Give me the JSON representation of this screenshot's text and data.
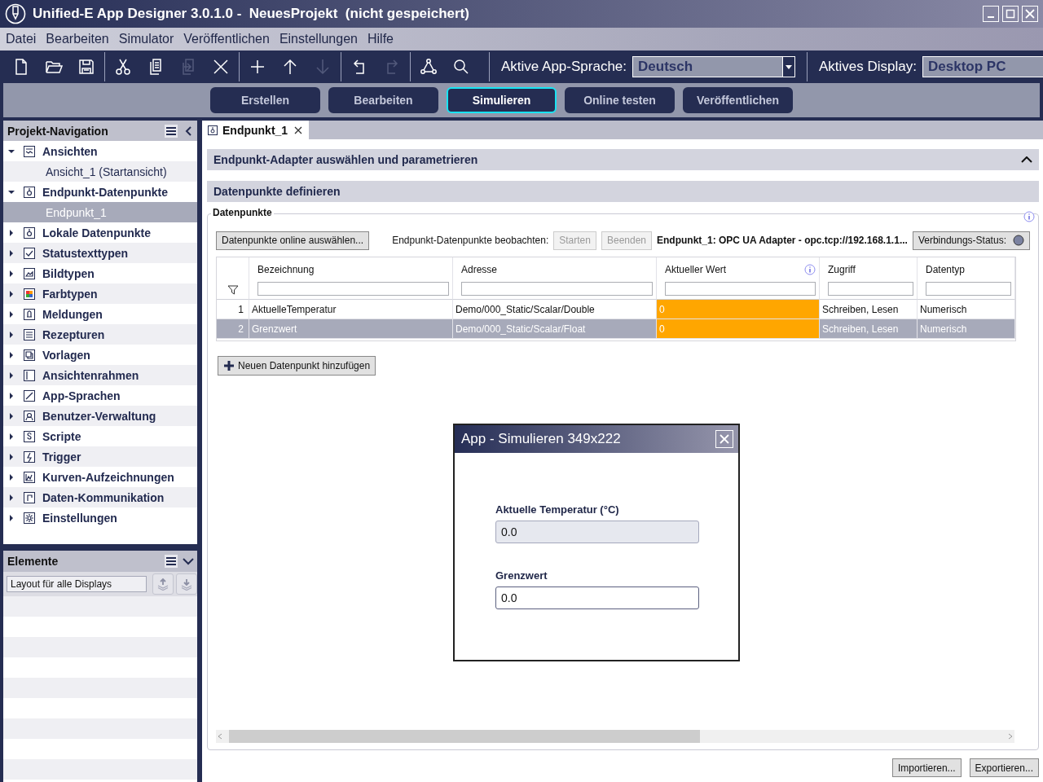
{
  "window": {
    "title": "Unified-E App Designer 3.0.1.0 -  NeuesProjekt  (nicht gespeichert)"
  },
  "menu": [
    "Datei",
    "Bearbeiten",
    "Simulator",
    "Veröffentlichen",
    "Einstellungen",
    "Hilfe"
  ],
  "toolbar": {
    "tools": [
      {
        "kind": "new",
        "disabled": false
      },
      {
        "kind": "open",
        "disabled": false
      },
      {
        "kind": "save",
        "disabled": false
      },
      {
        "kind": "sep"
      },
      {
        "kind": "cut",
        "disabled": false
      },
      {
        "kind": "copy",
        "disabled": false
      },
      {
        "kind": "paste",
        "disabled": true
      },
      {
        "kind": "delete",
        "disabled": false
      },
      {
        "kind": "sep"
      },
      {
        "kind": "add",
        "disabled": false
      },
      {
        "kind": "up",
        "disabled": false
      },
      {
        "kind": "down",
        "disabled": true
      },
      {
        "kind": "sep"
      },
      {
        "kind": "undo",
        "disabled": false
      },
      {
        "kind": "redo",
        "disabled": true
      },
      {
        "kind": "sep"
      },
      {
        "kind": "network",
        "disabled": false
      },
      {
        "kind": "search",
        "disabled": false
      }
    ],
    "language": {
      "label": "Aktive App-Sprache:",
      "value": "Deutsch"
    },
    "display": {
      "label": "Aktives Display:",
      "value": "Desktop PC"
    }
  },
  "modes": [
    {
      "label": "Erstellen",
      "selected": false
    },
    {
      "label": "Bearbeiten",
      "selected": false
    },
    {
      "label": "Simulieren",
      "selected": true
    },
    {
      "label": "Online testen",
      "selected": false
    },
    {
      "label": "Veröffentlichen",
      "selected": false
    }
  ],
  "navigation": {
    "title": "Projekt-Navigation",
    "items": [
      {
        "label": "Ansichten",
        "kind": "views",
        "expanded": true,
        "selected": false,
        "children": [
          {
            "label": "Ansicht_1 (Startansicht)",
            "selected": false
          }
        ]
      },
      {
        "label": "Endpunkt-Datenpunkte",
        "kind": "endpoint",
        "expanded": true,
        "selected": false,
        "children": [
          {
            "label": "Endpunkt_1",
            "selected": true
          }
        ]
      },
      {
        "label": "Lokale Datenpunkte",
        "kind": "endpoint",
        "expanded": false,
        "selected": false
      },
      {
        "label": "Statustexttypen",
        "kind": "check",
        "expanded": false,
        "selected": false
      },
      {
        "label": "Bildtypen",
        "kind": "image",
        "expanded": false,
        "selected": false
      },
      {
        "label": "Farbtypen",
        "kind": "color",
        "expanded": false,
        "selected": false
      },
      {
        "label": "Meldungen",
        "kind": "bell",
        "expanded": false,
        "selected": false
      },
      {
        "label": "Rezepturen",
        "kind": "list",
        "expanded": false,
        "selected": false
      },
      {
        "label": "Vorlagen",
        "kind": "template",
        "expanded": false,
        "selected": false
      },
      {
        "label": "Ansichtenrahmen",
        "kind": "frame",
        "expanded": false,
        "selected": false
      },
      {
        "label": "App-Sprachen",
        "kind": "language",
        "expanded": false,
        "selected": false
      },
      {
        "label": "Benutzer-Verwaltung",
        "kind": "user",
        "expanded": false,
        "selected": false
      },
      {
        "label": "Scripte",
        "kind": "script",
        "expanded": false,
        "selected": false
      },
      {
        "label": "Trigger",
        "kind": "trigger",
        "expanded": false,
        "selected": false
      },
      {
        "label": "Kurven-Aufzeichnungen",
        "kind": "chart",
        "expanded": false,
        "selected": false
      },
      {
        "label": "Daten-Kommunikation",
        "kind": "comm",
        "expanded": false,
        "selected": false
      },
      {
        "label": "Einstellungen",
        "kind": "gear",
        "expanded": false,
        "selected": false
      }
    ]
  },
  "elements": {
    "title": "Elemente",
    "layout": "Layout für alle Displays"
  },
  "editor": {
    "tab": "Endpunkt_1",
    "sections": [
      {
        "title": "Endpunkt-Adapter auswählen und parametrieren",
        "collapsed": true
      },
      {
        "title": "Datenpunkte definieren",
        "collapsed": false
      }
    ],
    "group": {
      "title": "Datenpunkte",
      "select_button": "Datenpunkte online auswählen...",
      "observe_label": "Endpunkt-Datenpunkte beobachten:",
      "start": {
        "label": "Starten",
        "disabled": true
      },
      "stop": {
        "label": "Beenden",
        "disabled": true
      },
      "adapter": "Endpunkt_1: OPC UA Adapter - opc.tcp://192.168.1.1...",
      "status_button": "Verbindungs-Status:"
    },
    "table": {
      "columns": [
        {
          "label": "Bezeichnung"
        },
        {
          "label": "Adresse"
        },
        {
          "label": "Aktueller Wert",
          "info": true
        },
        {
          "label": "Zugriff"
        },
        {
          "label": "Datentyp"
        }
      ],
      "rows": [
        {
          "number": "1",
          "selected": false,
          "cells": [
            "AktuelleTemperatur",
            "Demo/000_Static/Scalar/Double",
            "0",
            "Schreiben, Lesen",
            "Numerisch"
          ]
        },
        {
          "number": "2",
          "selected": true,
          "cells": [
            "Grenzwert",
            "Demo/000_Static/Scalar/Float",
            "0",
            "Schreiben, Lesen",
            "Numerisch"
          ]
        }
      ]
    },
    "add_button": "Neuen Datenpunkt hinzufügen",
    "footer_buttons": [
      "Importieren...",
      "Exportieren..."
    ]
  },
  "dialog": {
    "title": "App - Simulieren 349x222",
    "fields": [
      {
        "label": "Aktuelle Temperatur (°C)",
        "value": "0.0",
        "readonly": true
      },
      {
        "label": "Grenzwert",
        "value": "0.0",
        "readonly": false
      }
    ]
  }
}
